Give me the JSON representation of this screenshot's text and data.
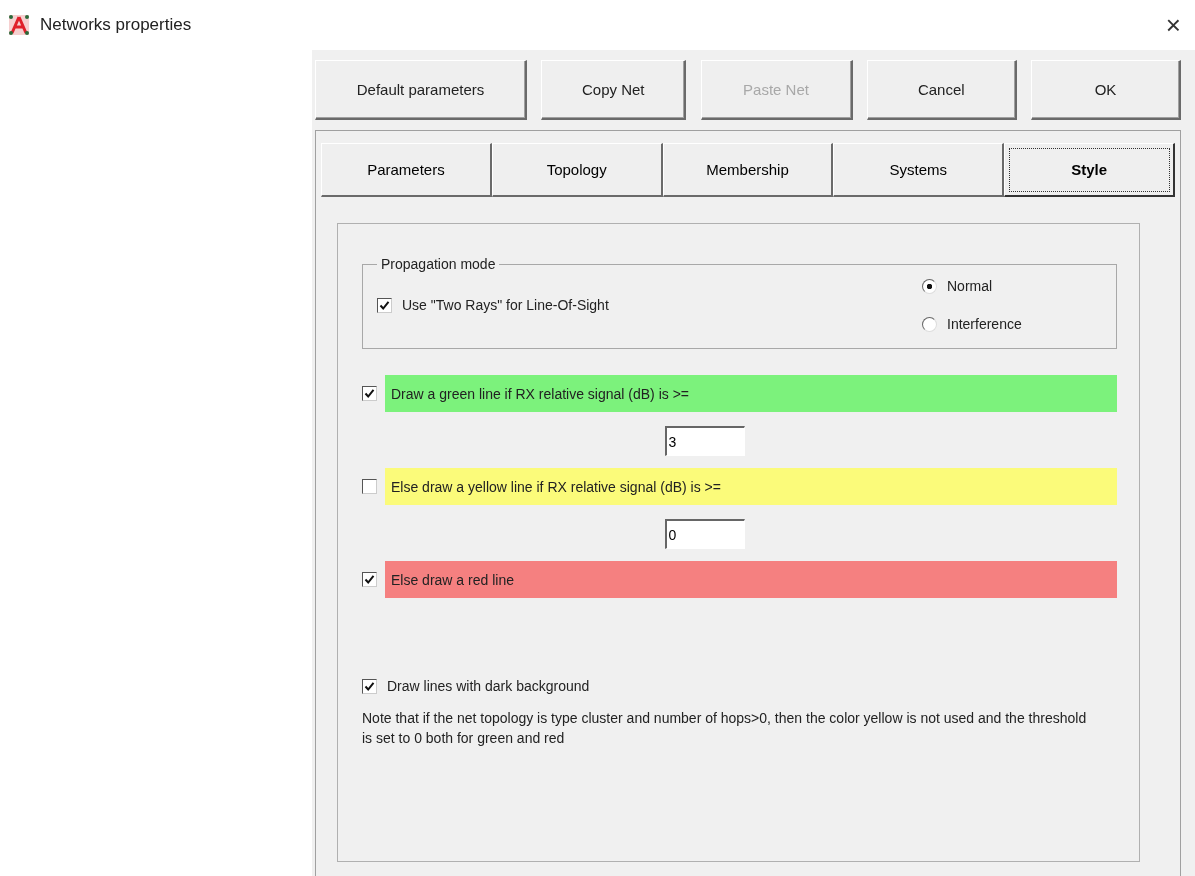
{
  "window": {
    "title": "Networks properties",
    "close": "×"
  },
  "buttons": [
    {
      "label": "Default parameters",
      "disabled": false
    },
    {
      "label": "Copy Net",
      "disabled": false
    },
    {
      "label": "Paste Net",
      "disabled": true
    },
    {
      "label": "Cancel",
      "disabled": false
    },
    {
      "label": "OK",
      "disabled": false
    }
  ],
  "tabs": [
    {
      "label": "Parameters",
      "selected": false
    },
    {
      "label": "Topology",
      "selected": false
    },
    {
      "label": "Membership",
      "selected": false
    },
    {
      "label": "Systems",
      "selected": false
    },
    {
      "label": "Style",
      "selected": true
    }
  ],
  "propagation": {
    "title": "Propagation mode",
    "two_rays": {
      "label": "Use \"Two Rays\" for Line-Of-Sight",
      "checked": true
    },
    "modes": [
      {
        "label": "Normal",
        "selected": true
      },
      {
        "label": "Interference",
        "selected": false
      }
    ]
  },
  "thresholds": [
    {
      "label": "Draw a green line if RX relative signal (dB) is >=",
      "checked": true,
      "color": "#7cf27c",
      "value": "3"
    },
    {
      "label": "Else draw a yellow line if RX relative signal (dB) is >=",
      "checked": false,
      "color": "#fbfb7a",
      "value": "0"
    },
    {
      "label": "Else draw a red line",
      "checked": true,
      "color": "#f58080"
    }
  ],
  "dark_background": {
    "label": "Draw lines with dark background",
    "checked": true
  },
  "note": "Note that if the net topology is type cluster and number of hops>0, then the color yellow is not used and the threshold is set to 0 both for green and red"
}
